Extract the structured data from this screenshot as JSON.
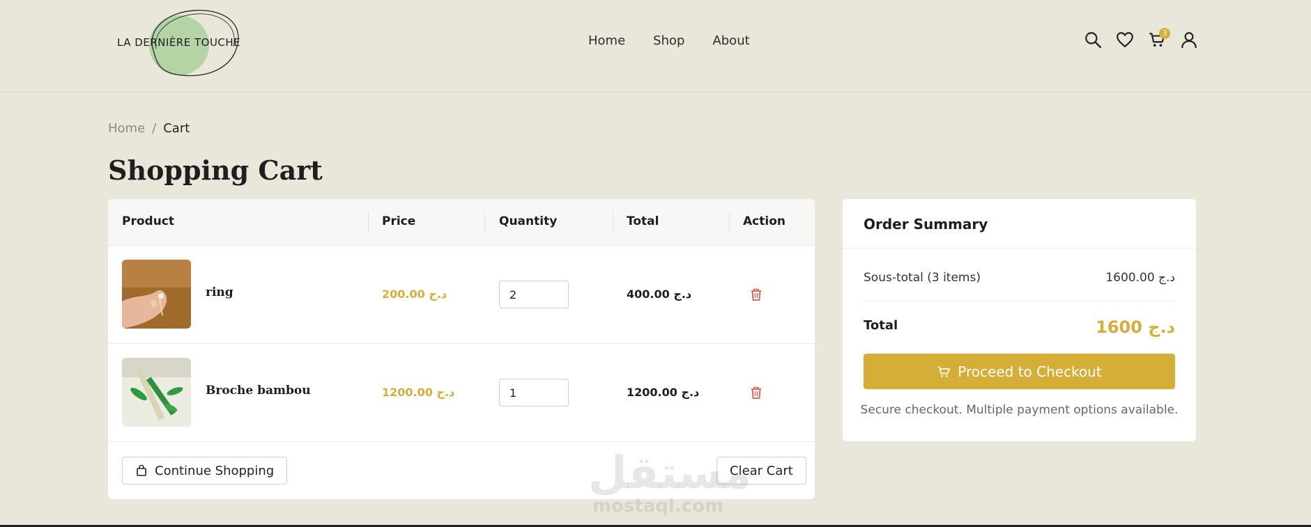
{
  "brand": {
    "name": "LA DERNIÈRE TOUCHE"
  },
  "nav": {
    "items": [
      "Home",
      "Shop",
      "About"
    ]
  },
  "header_icons": {
    "search": "search-icon",
    "wishlist": "heart-icon",
    "cart": "cart-icon",
    "account": "user-icon",
    "cart_count": "3"
  },
  "breadcrumb": {
    "home": "Home",
    "separator": "/",
    "current": "Cart"
  },
  "page": {
    "title": "Shopping Cart"
  },
  "cart": {
    "headers": [
      "Product",
      "Price",
      "Quantity",
      "Total",
      "Action"
    ],
    "items": [
      {
        "name": "ring",
        "price": "200.00 د.ج",
        "quantity": "2",
        "total": "400.00 د.ج"
      },
      {
        "name": "Broche bambou",
        "price": "1200.00 د.ج",
        "quantity": "1",
        "total": "1200.00 د.ج"
      }
    ],
    "continue_label": "Continue Shopping",
    "clear_label": "Clear Cart"
  },
  "summary": {
    "title": "Order Summary",
    "subtotal_label": "Sous-total (3 items)",
    "subtotal_value": "1600.00 د.ج",
    "total_label": "Total",
    "total_value": "1600 د.ج",
    "checkout_label": "Proceed to Checkout",
    "note": "Secure checkout. Multiple payment options available."
  },
  "watermark": {
    "arabic": "مستقل",
    "latin": "mostaql.com"
  },
  "colors": {
    "accent": "#d4ae37",
    "background": "#e9e6da",
    "danger": "#e05a4f"
  }
}
